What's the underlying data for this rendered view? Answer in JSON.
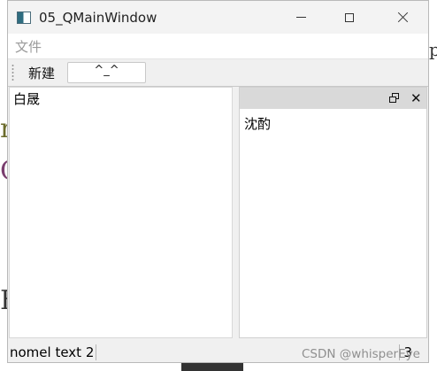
{
  "window": {
    "title": "05_QMainWindow"
  },
  "menubar": {
    "items": [
      {
        "label": "文件"
      }
    ]
  },
  "toolbar": {
    "new_label": "新建",
    "input_value": "^_^"
  },
  "central": {
    "text": "白晟"
  },
  "dock": {
    "text": "沈酌"
  },
  "statusbar": {
    "left_text": "nomel text 2",
    "right_text": "3"
  },
  "watermark": {
    "text": "CSDN @whisperEye"
  },
  "background": {
    "glyph_top_right": "p",
    "glyph_left_1": "r",
    "glyph_left_2": "C",
    "glyph_left_3": "F"
  }
}
